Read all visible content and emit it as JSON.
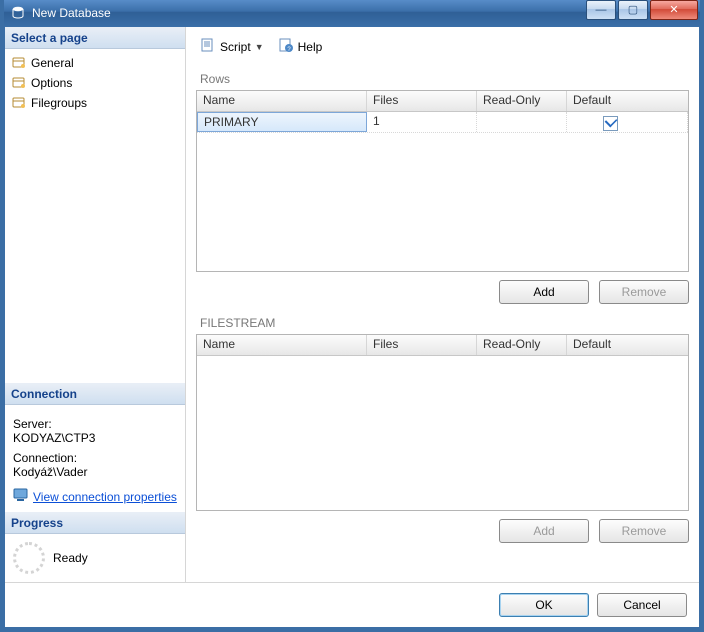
{
  "window": {
    "title": "New Database"
  },
  "winbuttons": {
    "min": "—",
    "max": "▢",
    "close": "✕"
  },
  "left": {
    "select_page": "Select a page",
    "pages": [
      "General",
      "Options",
      "Filegroups"
    ],
    "connection_head": "Connection",
    "server_label": "Server:",
    "server_value": "KODYAZ\\CTP3",
    "connection_label": "Connection:",
    "connection_value": "Kodyáž\\Vader",
    "view_props": "View connection properties",
    "progress_head": "Progress",
    "progress_state": "Ready"
  },
  "toolbar": {
    "script": "Script",
    "help": "Help"
  },
  "rows_section": {
    "label": "Rows",
    "cols": {
      "name": "Name",
      "files": "Files",
      "ro": "Read-Only",
      "def": "Default"
    },
    "rows": [
      {
        "name": "PRIMARY",
        "files": "1",
        "ro": "",
        "def_checked": true
      }
    ],
    "add": "Add",
    "remove": "Remove"
  },
  "fs_section": {
    "label": "FILESTREAM",
    "cols": {
      "name": "Name",
      "files": "Files",
      "ro": "Read-Only",
      "def": "Default"
    },
    "add": "Add",
    "remove": "Remove"
  },
  "footer": {
    "ok": "OK",
    "cancel": "Cancel"
  }
}
